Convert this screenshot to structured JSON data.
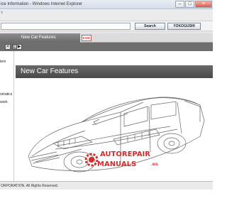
{
  "window": {
    "title": "ice Information - Windows Internet Explorer",
    "controls": [
      "–",
      "□",
      "×"
    ]
  },
  "menubar": {
    "text": "?"
  },
  "search": {
    "value": "",
    "search_label": "Search",
    "yokogushi_label": "YOKOGUSHI"
  },
  "tabs": {
    "active_label": "New Car Features",
    "ewd_label": "EWD"
  },
  "toolbar": {
    "close_glyph": "✕",
    "prev_glyph": "◀",
    "next_glyph": "▶"
  },
  "sidebar": {
    "items": [
      "tem",
      "omatics",
      "work."
    ]
  },
  "content": {
    "banner_title": "New Car Features"
  },
  "watermark": {
    "line1": "AUTOREPAIR",
    "line2": "MANUALS",
    "suffix": ".ws"
  },
  "status": {
    "text": "ORPORATION. All Rights Reserved."
  },
  "colors": {
    "banner": "#555555",
    "watermark": "#d42b2b",
    "ewd_tab_text": "#cc0000"
  }
}
